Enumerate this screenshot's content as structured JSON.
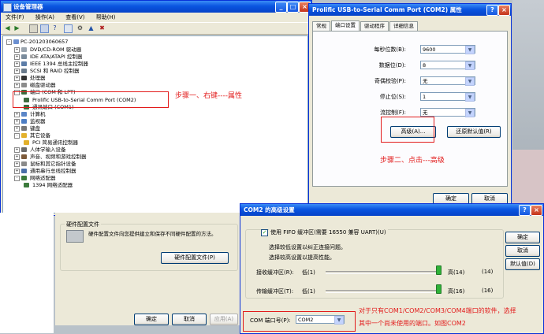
{
  "device_manager": {
    "title": "设备管理器",
    "menu": [
      "文件(F)",
      "操作(A)",
      "查看(V)",
      "帮助(H)"
    ],
    "tree": {
      "root": "PC-201203060657",
      "items": [
        "DVD/CD-ROM 驱动器",
        "IDE ATA/ATAPI 控制器",
        "IEEE 1394 总线主控制器",
        "SCSI 和 RAID 控制器",
        "处理器",
        "磁盘驱动器",
        "端口 (COM 和 LPT)",
        "Prolific USB-to-Serial Comm Port (COM2)",
        "通讯端口 (COM1)",
        "计算机",
        "监视器",
        "键盘",
        "其它设备",
        "PCI 简易通讯控制器",
        "人体学输入设备",
        "声音、视频和游戏控制器",
        "鼠标和其它指针设备",
        "通用串行总线控制器",
        "网络适配器",
        "1394 网络适配器"
      ]
    }
  },
  "annotations": {
    "step1": "步骤一、右键----属性",
    "step2": "步骤二、点击---高级",
    "step3_line1": "对于只有COM1/COM2/COM3/COM4端口的软件，选择",
    "step3_line2": "其中一个尚未使用的端口。如图COM2"
  },
  "properties_dialog": {
    "title": "Prolific USB-to-Serial Comm Port (COM2) 属性",
    "tabs": [
      "常规",
      "端口设置",
      "驱动程序",
      "详细信息"
    ],
    "fields": [
      {
        "label": "每秒位数(B):",
        "value": "9600"
      },
      {
        "label": "数据位(D):",
        "value": "8"
      },
      {
        "label": "奇偶校验(P):",
        "value": "无"
      },
      {
        "label": "停止位(S):",
        "value": "1"
      },
      {
        "label": "流控制(F):",
        "value": "无"
      }
    ],
    "advanced_button": "高级(A)...",
    "restore_button": "还原默认值(R)",
    "ok": "确定",
    "cancel": "取消"
  },
  "hardware_profile": {
    "group_title": "硬件配置文件",
    "description": "硬件配置文件向您提供建立和保存不同硬件配置的方法。",
    "button": "硬件配置文件(P)",
    "ok": "确定",
    "cancel": "取消",
    "apply": "应用(A)"
  },
  "advanced_dialog": {
    "title": "COM2 的高级设置",
    "fifo_label": "使用 FIFO 缓冲区(需要 16550 兼容 UART)(U)",
    "fifo_checked": true,
    "hint1": "选择较低设置以纠正连接问题。",
    "hint2": "选择较高设置以提高性能。",
    "rx_label": "接收缓冲区(R):",
    "tx_label": "传输缓冲区(T):",
    "low_rx": "低(1)",
    "high_rx": "高(14)",
    "rx_value": "(14)",
    "low_tx": "低(1)",
    "high_tx": "高(16)",
    "tx_value": "(16)",
    "port_label": "COM 端口号(P):",
    "port_value": "COM2",
    "ok": "确定",
    "cancel": "取消",
    "defaults": "默认值(D)"
  }
}
